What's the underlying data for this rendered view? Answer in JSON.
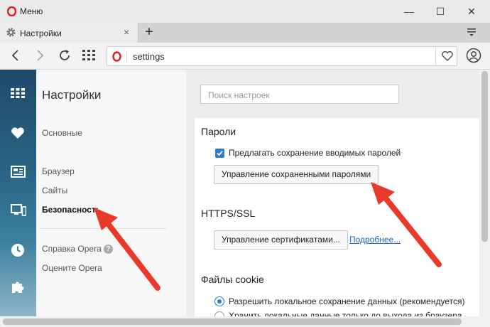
{
  "window": {
    "title": "Меню",
    "minimize": "—",
    "maximize": "☐",
    "close": "✕"
  },
  "tab": {
    "label": "Настройки",
    "close": "×",
    "new_tab": "+"
  },
  "address": {
    "url": "settings"
  },
  "nav": {
    "title": "Настройки",
    "items": [
      {
        "label": "Основные"
      },
      {
        "label": "Браузер"
      },
      {
        "label": "Сайты"
      },
      {
        "label": "Безопасность"
      },
      {
        "label": "Справка Opera"
      },
      {
        "label": "Оцените Opera"
      }
    ],
    "help_mark": "?"
  },
  "search": {
    "placeholder": "Поиск настроек"
  },
  "passwords": {
    "title": "Пароли",
    "offer_save_label": "Предлагать сохранение вводимых паролей",
    "offer_save_checked": true,
    "manage_button": "Управление сохраненными паролями"
  },
  "https": {
    "title": "HTTPS/SSL",
    "manage_certs_button": "Управление сертификатами...",
    "more_link": "Подробнее..."
  },
  "cookies": {
    "title": "Файлы cookie",
    "allow_local_label": "Разрешить локальное сохранение данных (рекомендуется)",
    "second_option_label": "Хранить локальные данные только до выхода из браузера"
  },
  "colors": {
    "accent": "#2e7bd6",
    "arrow": "#e8392b",
    "sidebar": "#2b6788",
    "link": "#1a62c3"
  }
}
